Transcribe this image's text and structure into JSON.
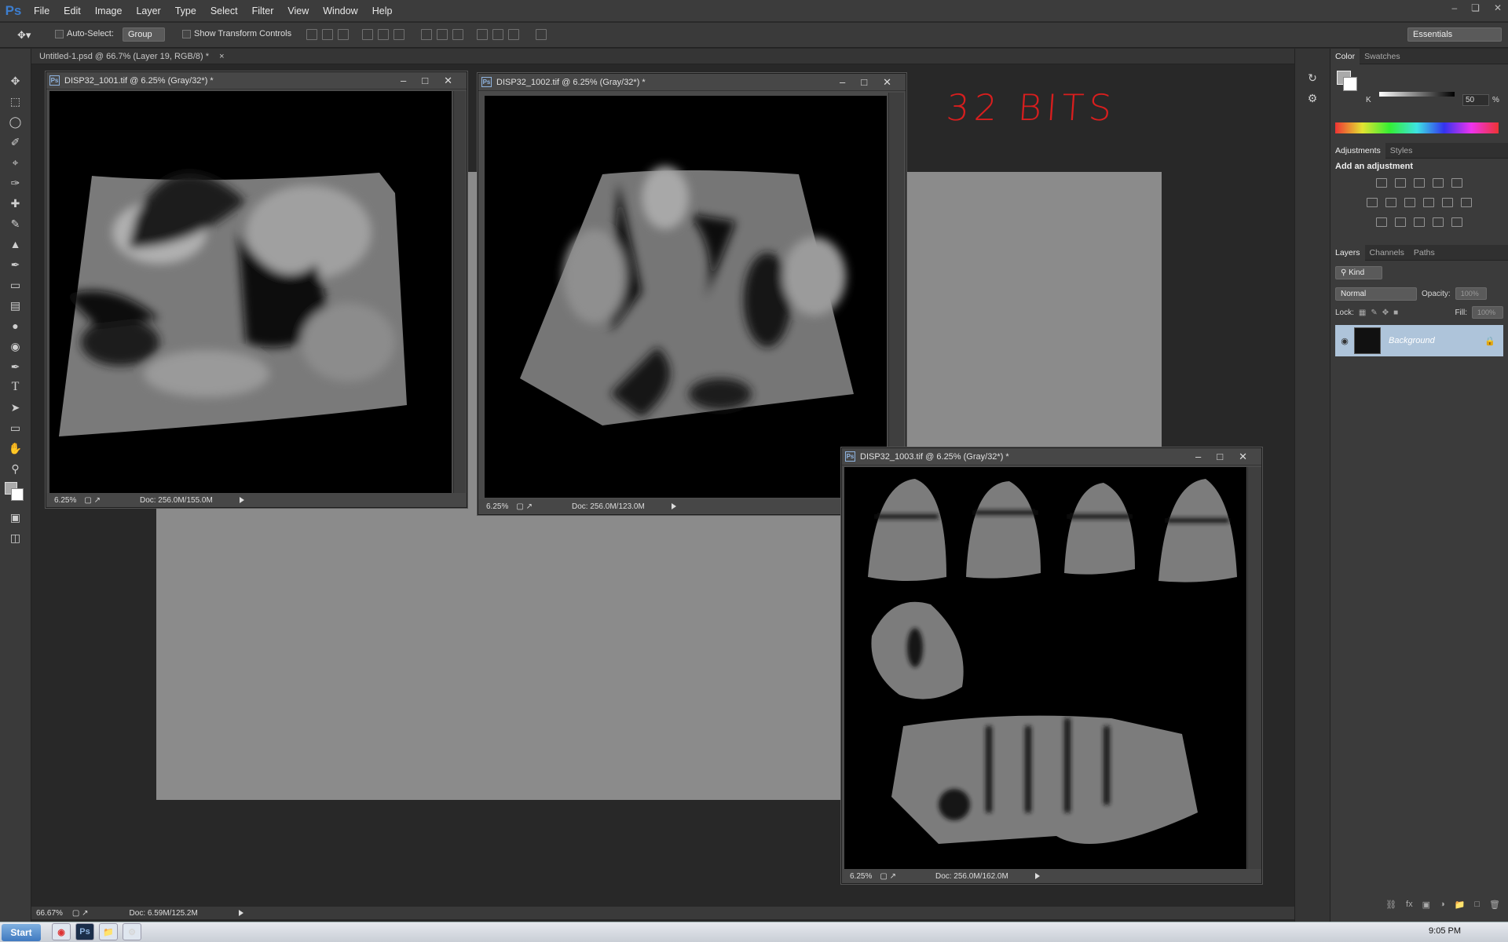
{
  "app": {
    "logo": "Ps"
  },
  "menu": [
    "File",
    "Edit",
    "Image",
    "Layer",
    "Type",
    "Select",
    "Filter",
    "View",
    "Window",
    "Help"
  ],
  "options_bar": {
    "auto_select_label": "Auto-Select:",
    "auto_select_value": "Group",
    "show_transform_label": "Show Transform Controls",
    "workspace": "Essentials"
  },
  "doc_tab": {
    "title": "Untitled-1.psd @ 66.7% (Layer 19, RGB/8) *"
  },
  "annotation": "32 BITS",
  "windows": [
    {
      "title": "DISP32_1001.tif @ 6.25% (Gray/32*) *",
      "zoom": "6.25%",
      "doc": "Doc: 256.0M/155.0M"
    },
    {
      "title": "DISP32_1002.tif @ 6.25% (Gray/32*) *",
      "zoom": "6.25%",
      "doc": "Doc: 256.0M/123.0M"
    },
    {
      "title": "DISP32_1003.tif @ 6.25% (Gray/32*) *",
      "zoom": "6.25%",
      "doc": "Doc: 256.0M/162.0M"
    }
  ],
  "main_status": {
    "zoom": "66.67%",
    "doc": "Doc: 6.59M/125.2M"
  },
  "color_panel": {
    "tab_active": "Color",
    "tab2": "Swatches",
    "k_label": "K",
    "k_value": "50",
    "pct": "%"
  },
  "adjustments_panel": {
    "tab_active": "Adjustments",
    "tab2": "Styles",
    "heading": "Add an adjustment"
  },
  "layers_panel": {
    "tabs": [
      "Layers",
      "Channels",
      "Paths"
    ],
    "kind": "Kind",
    "blend": "Normal",
    "opacity_label": "Opacity:",
    "opacity_value": "100%",
    "lock_label": "Lock:",
    "fill_label": "Fill:",
    "fill_value": "100%",
    "layer_name": "Background"
  },
  "taskbar": {
    "start": "Start",
    "clock": "9:05 PM"
  }
}
